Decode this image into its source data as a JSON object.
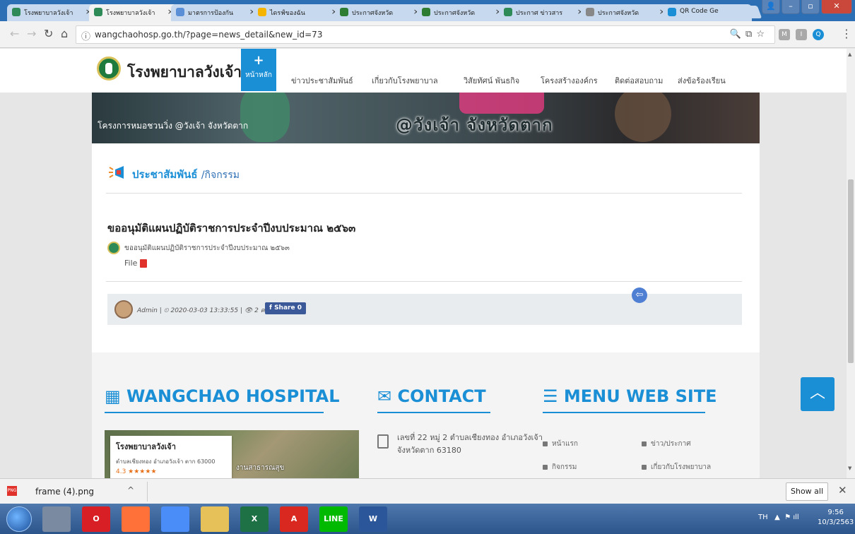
{
  "browser": {
    "tabs": [
      {
        "label": "โรงพยาบาลวังเจ้า",
        "icon_color": "#2e8b57",
        "active": false
      },
      {
        "label": "โรงพยาบาลวังเจ้า",
        "icon_color": "#2e8b57",
        "active": true
      },
      {
        "label": "มาตรการป้องกัน",
        "icon_color": "#5b8fd6",
        "active": false
      },
      {
        "label": "ไดรฟ์ของฉัน",
        "icon_color": "#f4b400",
        "active": false
      },
      {
        "label": "ประกาศจังหวัด",
        "icon_color": "#2e7d32",
        "active": false
      },
      {
        "label": "ประกาศจังหวัด",
        "icon_color": "#2e7d32",
        "active": false
      },
      {
        "label": "ประกาศ ข่าวสาร",
        "icon_color": "#2e8b57",
        "active": false
      },
      {
        "label": "ประกาศจังหวัด",
        "icon_color": "#888888",
        "active": false
      },
      {
        "label": "QR Code Ge",
        "icon_color": "#1b8fd6",
        "active": false
      }
    ],
    "url": "wangchaohosp.go.th/?page=news_detail&new_id=73",
    "tab_close_glyph": "×",
    "extensions": [
      {
        "label": "M",
        "color": "#a9a9a9"
      },
      {
        "label": "I",
        "color": "#a9a9a9"
      },
      {
        "label": "Q",
        "color": "#1b8fd6"
      }
    ]
  },
  "site": {
    "logo_text": "โรงพยาบาลวังเจ้า",
    "nav_home": "หน้าหลัก",
    "nav_items": [
      "ข่าวประชาสัมพันธ์",
      "เกี่ยวกับโรงพยาบาล",
      "วิสัยทัศน์ พันธกิจ",
      "โครงสร้างองค์กร",
      "ติดต่อสอบถาม",
      "ส่งข้อร้องเรียน"
    ],
    "banner_caption": "โครงการหมอชวนวิ่ง @วังเจ้า จังหวัดตาก",
    "banner_big": "@วังเจ้า จังหวัดตาก"
  },
  "article": {
    "section": "ประชาสัมพันธ์",
    "subsection": "/กิจกรรม",
    "title": "ขออนุมัติแผนปฏิบัติราชการประจำปีงบประมาณ ๒๕๖๓",
    "desc": "ขออนุมัติแผนปฏิบัติราชการประจำปีงบประมาณ ๒๕๖๓",
    "file_label": "File",
    "meta": "Admin | ⏲ 2020-03-03 13:33:55 | 👁 2 ครั้ง",
    "share_label": "Share 0"
  },
  "footer": {
    "hospital_title": "WANGCHAO HOSPITAL",
    "contact_title": "CONTACT",
    "menu_title": "MENU WEB SITE",
    "map_name": "โรงพยาบาลวังเจ้า",
    "map_addr": "ตำบลเชียงทอง อำเภอวังเจ้า ตาก 63000",
    "map_rating": "4.3 ★★★★★",
    "map_label": "งานสาธารณสุข",
    "address": "เลขที่ 22 หมู่ 2 ตำบลเชียงทอง อำเภอวังเจ้า จังหวัดตาก 63180",
    "menu_links": [
      "หน้าแรก",
      "ข่าว/ประกาศ",
      "กิจกรรม",
      "เกี่ยวกับโรงพยาบาล"
    ]
  },
  "download": {
    "filename": "frame (4).png",
    "show_all": "Show all"
  },
  "taskbar": {
    "apps": [
      {
        "label": "",
        "color": "#7a8aa0"
      },
      {
        "label": "O",
        "color": "#d81f26"
      },
      {
        "label": "",
        "color": "#ff7139"
      },
      {
        "label": "",
        "color": "#4a8df8"
      },
      {
        "label": "",
        "color": "#e6c15a"
      },
      {
        "label": "X",
        "color": "#1e7145"
      },
      {
        "label": "A",
        "color": "#d9281f"
      },
      {
        "label": "LINE",
        "color": "#00b900"
      },
      {
        "label": "W",
        "color": "#2b579a"
      }
    ],
    "lang": "TH",
    "time": "9:56",
    "date": "10/3/2563"
  }
}
